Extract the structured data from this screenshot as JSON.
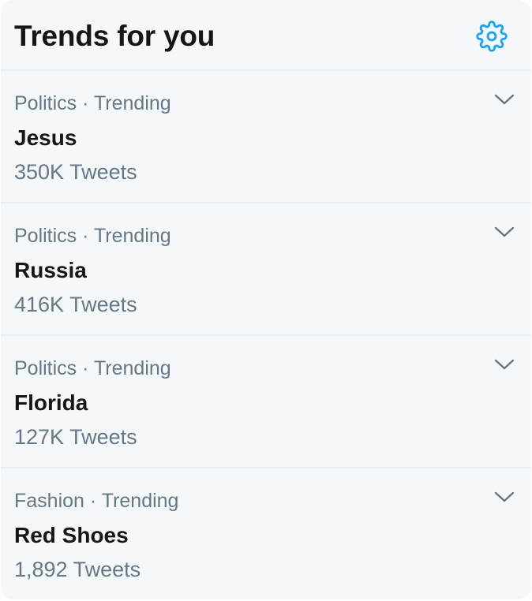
{
  "panel": {
    "title": "Trends for you",
    "settings_icon": "gear-icon"
  },
  "trends": [
    {
      "category": "Politics",
      "separator": " · ",
      "status": "Trending",
      "name": "Jesus",
      "count": "350K Tweets",
      "menu_icon": "chevron-down-icon"
    },
    {
      "category": "Politics",
      "separator": " · ",
      "status": "Trending",
      "name": "Russia",
      "count": "416K Tweets",
      "menu_icon": "chevron-down-icon"
    },
    {
      "category": "Politics",
      "separator": " · ",
      "status": "Trending",
      "name": "Florida",
      "count": "127K Tweets",
      "menu_icon": "chevron-down-icon"
    },
    {
      "category": "Fashion",
      "separator": " · ",
      "status": "Trending",
      "name": "Red Shoes",
      "count": "1,892 Tweets",
      "menu_icon": "chevron-down-icon"
    }
  ],
  "colors": {
    "accent": "#1da1f2",
    "background": "#f5f8fa",
    "divider": "#e6ecf0",
    "primary_text": "#14171a",
    "secondary_text": "#657786"
  }
}
